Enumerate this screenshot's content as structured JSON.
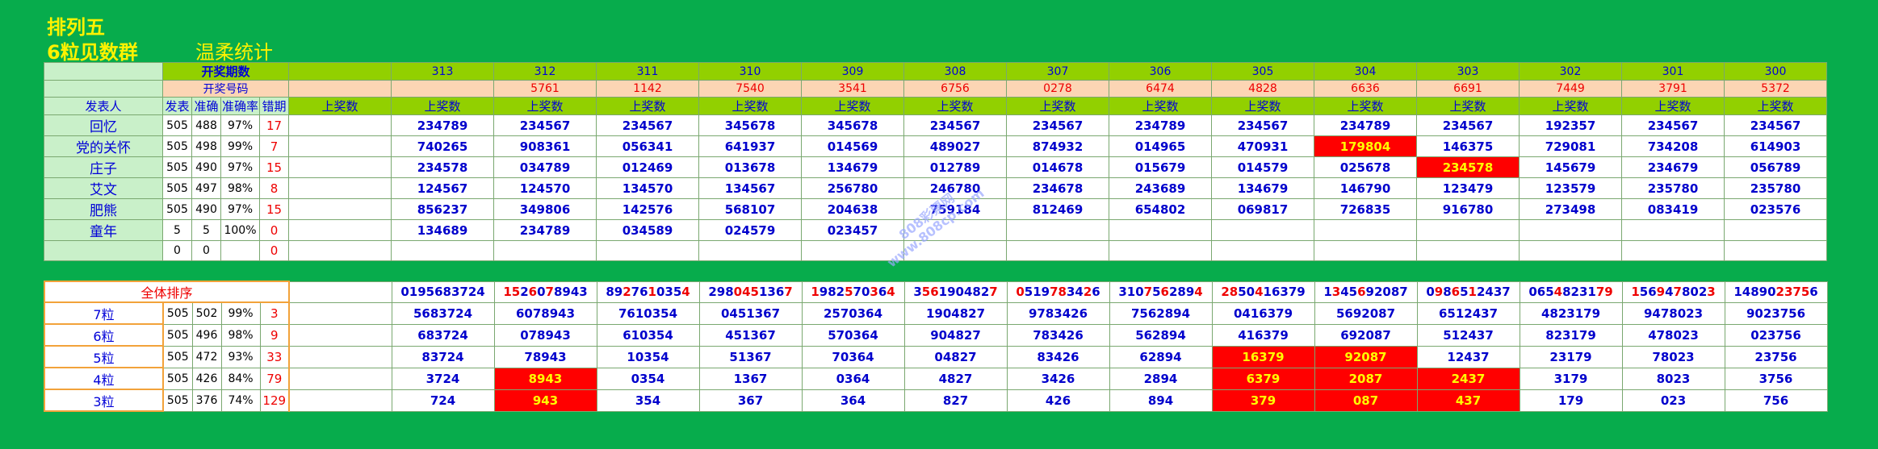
{
  "title": {
    "line1": "排列五",
    "line2": "6粒见数群",
    "subtitle": "温柔统计"
  },
  "header": {
    "period_label": "开奖期数",
    "number_label": "开奖号码",
    "poster_label": "发表人",
    "col_published": "发表",
    "col_correct": "准确",
    "col_rate": "准确率",
    "col_miss": "错期",
    "upcoming_label": "上奖数",
    "periods": [
      "313",
      "312",
      "311",
      "310",
      "309",
      "308",
      "307",
      "306",
      "305",
      "304",
      "303",
      "302",
      "301",
      "300"
    ],
    "draw_numbers": [
      "",
      "5761",
      "1142",
      "7540",
      "3541",
      "6756",
      "0278",
      "6474",
      "4828",
      "6636",
      "6691",
      "7449",
      "3791",
      "5372"
    ]
  },
  "posters": [
    {
      "name": "回忆",
      "published": "505",
      "correct": "488",
      "rate": "97%",
      "miss": "17",
      "values": [
        "",
        "234789",
        "234567",
        "234567",
        "345678",
        "345678",
        "234567",
        "234567",
        "234789",
        "234567",
        "234789",
        "234567",
        "192357",
        "234567",
        "234567"
      ]
    },
    {
      "name": "党的关怀",
      "published": "505",
      "correct": "498",
      "rate": "99%",
      "miss": "7",
      "values": [
        "",
        "740265",
        "908361",
        "056341",
        "641937",
        "014569",
        "489027",
        "874932",
        "014965",
        "470931",
        "179804",
        "146375",
        "729081",
        "734208",
        "614903"
      ]
    },
    {
      "name": "庄子",
      "published": "505",
      "correct": "490",
      "rate": "97%",
      "miss": "15",
      "values": [
        "",
        "234578",
        "034789",
        "012469",
        "013678",
        "134679",
        "012789",
        "014678",
        "015679",
        "014579",
        "025678",
        "234578",
        "145679",
        "234679",
        "056789"
      ]
    },
    {
      "name": "艾文",
      "published": "505",
      "correct": "497",
      "rate": "98%",
      "miss": "8",
      "values": [
        "",
        "124567",
        "124570",
        "134570",
        "134567",
        "256780",
        "246780",
        "234678",
        "243689",
        "134679",
        "146790",
        "123479",
        "123579",
        "235780",
        "235780"
      ]
    },
    {
      "name": "肥熊",
      "published": "505",
      "correct": "490",
      "rate": "97%",
      "miss": "15",
      "values": [
        "",
        "856237",
        "349806",
        "142576",
        "568107",
        "204638",
        "759184",
        "812469",
        "654802",
        "069817",
        "726835",
        "916780",
        "273498",
        "083419",
        "023576"
      ]
    },
    {
      "name": "童年",
      "published": "5",
      "correct": "5",
      "rate": "100%",
      "miss": "0",
      "values": [
        "",
        "134689",
        "234789",
        "034589",
        "024579",
        "023457",
        "",
        "",
        "",
        "",
        "",
        "",
        "",
        "",
        ""
      ]
    },
    {
      "name": "",
      "published": "0",
      "correct": "0",
      "rate": "",
      "miss": "0",
      "values": [
        "",
        "",
        "",
        "",
        "",
        "",
        "",
        "",
        "",
        "",
        "",
        "",
        "",
        "",
        ""
      ]
    }
  ],
  "ranking": {
    "header_label": "全体排序",
    "full_sort": [
      "",
      "0195683724",
      "1526078943",
      "8927610354",
      "2980451367",
      "1982570364",
      "3561904827",
      "0519783426",
      "3107562894",
      "2850416379",
      "1345692087",
      "0986512437",
      "0654823179",
      "1569478023",
      "1489023756"
    ],
    "levels": [
      {
        "label": "7粒",
        "published": "505",
        "correct": "502",
        "rate": "99%",
        "miss": "3",
        "values": [
          "",
          "5683724",
          "6078943",
          "7610354",
          "0451367",
          "2570364",
          "1904827",
          "9783426",
          "7562894",
          "0416379",
          "5692087",
          "6512437",
          "4823179",
          "9478023",
          "9023756"
        ]
      },
      {
        "label": "6粒",
        "published": "505",
        "correct": "496",
        "rate": "98%",
        "miss": "9",
        "values": [
          "",
          "683724",
          "078943",
          "610354",
          "451367",
          "570364",
          "904827",
          "783426",
          "562894",
          "416379",
          "692087",
          "512437",
          "823179",
          "478023",
          "023756"
        ]
      },
      {
        "label": "5粒",
        "published": "505",
        "correct": "472",
        "rate": "93%",
        "miss": "33",
        "values": [
          "",
          "83724",
          "78943",
          "10354",
          "51367",
          "70364",
          "04827",
          "83426",
          "62894",
          "16379",
          "92087",
          "12437",
          "23179",
          "78023",
          "23756"
        ]
      },
      {
        "label": "4粒",
        "published": "505",
        "correct": "426",
        "rate": "84%",
        "miss": "79",
        "values": [
          "",
          "3724",
          "8943",
          "0354",
          "1367",
          "0364",
          "4827",
          "3426",
          "2894",
          "6379",
          "2087",
          "2437",
          "3179",
          "8023",
          "3756"
        ]
      },
      {
        "label": "3粒",
        "published": "505",
        "correct": "376",
        "rate": "74%",
        "miss": "129",
        "values": [
          "",
          "724",
          "943",
          "354",
          "367",
          "364",
          "827",
          "426",
          "894",
          "379",
          "087",
          "437",
          "179",
          "023",
          "756"
        ]
      }
    ]
  },
  "highlights": {
    "top": [
      [
        1,
        10
      ],
      [
        2,
        11
      ]
    ],
    "bottom": [
      [
        2,
        9
      ],
      [
        2,
        10
      ],
      [
        3,
        2
      ],
      [
        3,
        9
      ],
      [
        3,
        10
      ],
      [
        3,
        11
      ],
      [
        4,
        2
      ],
      [
        4,
        9
      ],
      [
        4,
        10
      ],
      [
        4,
        11
      ]
    ]
  },
  "colors": {
    "background": "#07ac4c",
    "header_lime": "#92d000",
    "peach": "#fcd5b4",
    "hit_red": "#ff0000",
    "hit_text": "#ffff00",
    "data_blue": "#0000cc",
    "title_yellow": "#fff200"
  },
  "watermark": {
    "line1": "808彩票网",
    "line2": "www.808cp.com"
  }
}
